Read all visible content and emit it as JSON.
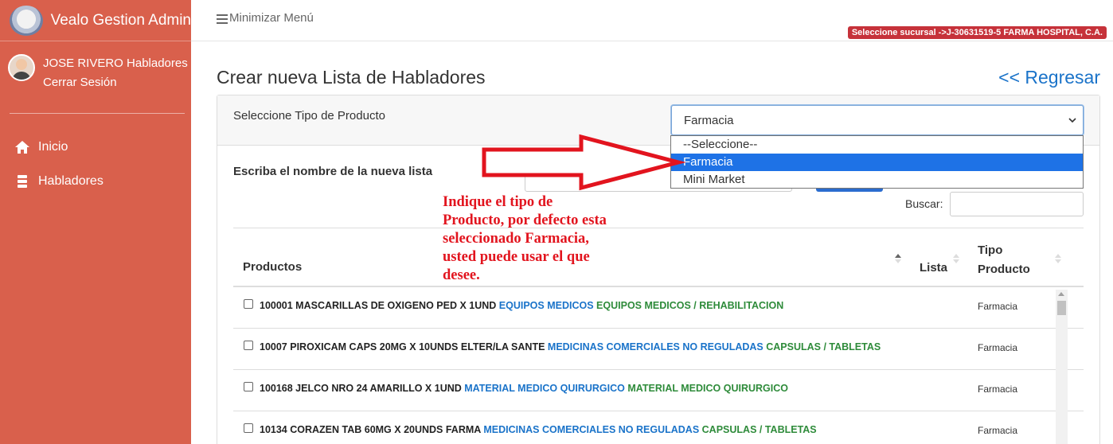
{
  "app": {
    "brand_name": "Vealo Gestion Admin"
  },
  "sidebar": {
    "user_name": "JOSE RIVERO Habladores",
    "logout_label": "Cerrar Sesión",
    "items": [
      {
        "label": "Inicio",
        "icon": "home-icon"
      },
      {
        "label": "Habladores",
        "icon": "list-icon"
      }
    ],
    "background_color": "#d9604c"
  },
  "topbar": {
    "minimize_label": "Minimizar Menú",
    "branch_badge": "Seleccione sucursal ->J-30631519-5 FARMA HOSPITAL, C.A."
  },
  "page": {
    "title": "Crear nueva Lista de Habladores",
    "back_label": "<< Regresar"
  },
  "form": {
    "tipo_label": "Seleccione Tipo de Producto",
    "tipo_value": "Farmacia",
    "tipo_options": [
      "--Seleccione--",
      "Farmacia",
      "Mini Market"
    ],
    "nombre_label": "Escriba el nombre de la nueva lista",
    "buscar_label": "Buscar:"
  },
  "table": {
    "headers": {
      "productos": "Productos",
      "lista": "Lista",
      "tipo_line1": "Tipo",
      "tipo_line2": "Producto"
    },
    "rows": [
      {
        "name": "100001 MASCARILLAS DE OXIGENO PED X 1UND",
        "category": "EQUIPOS MEDICOS",
        "subcategory": "EQUIPOS MEDICOS / REHABILITACION",
        "tipo": "Farmacia"
      },
      {
        "name": "10007 PIROXICAM CAPS 20MG X 10UNDS ELTER/LA SANTE",
        "category": "MEDICINAS COMERCIALES NO REGULADAS",
        "subcategory": "CAPSULAS / TABLETAS",
        "tipo": "Farmacia"
      },
      {
        "name": "100168 JELCO NRO 24 AMARILLO X 1UND",
        "category": "MATERIAL MEDICO QUIRURGICO",
        "subcategory": "MATERIAL MEDICO QUIRURGICO",
        "tipo": "Farmacia"
      },
      {
        "name": "10134 CORAZEN TAB 60MG X 20UNDS FARMA",
        "category": "MEDICINAS COMERCIALES NO REGULADAS",
        "subcategory": "CAPSULAS / TABLETAS",
        "tipo": "Farmacia"
      }
    ]
  },
  "annotation": {
    "lines": [
      "Indique el tipo de",
      "Producto, por defecto esta",
      "seleccionado Farmacia,",
      "usted puede usar el que",
      "desee."
    ],
    "color": "#e2141e"
  },
  "colors": {
    "link": "#1a73c9",
    "subcategory": "#2e8b3a",
    "badge": "#c6323a",
    "selected_option": "#1e72e6"
  }
}
